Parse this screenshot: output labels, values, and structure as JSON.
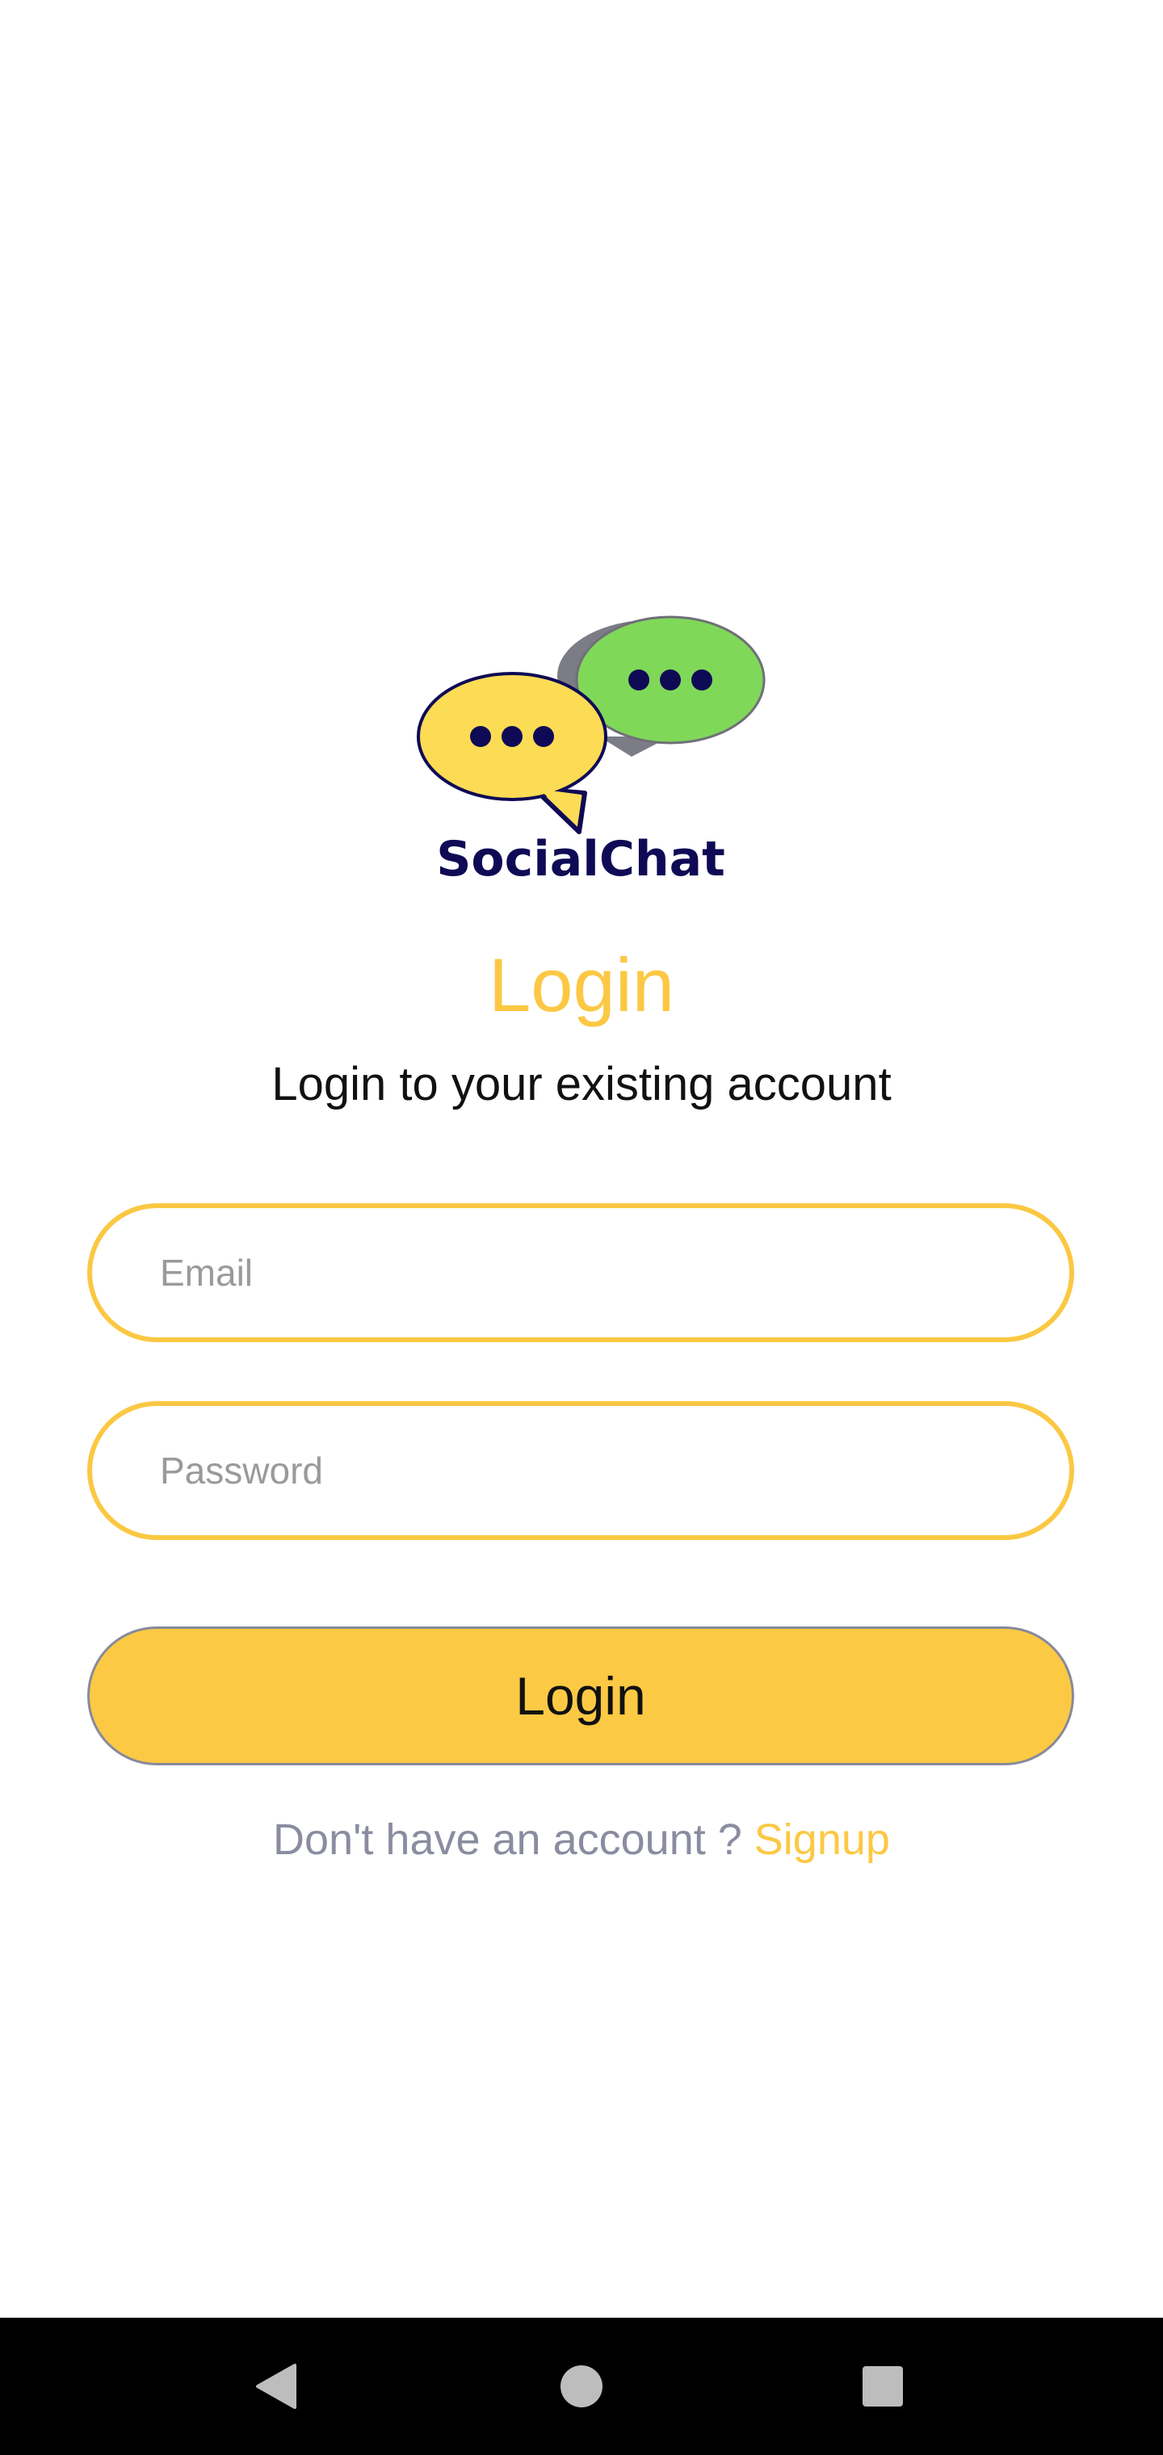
{
  "logo": {
    "brand_text": "SocialChat",
    "icon": "chat-bubbles-logo-icon",
    "colors": {
      "yellow": "#fcdc55",
      "green": "#7fd858",
      "navy": "#0f0a55"
    }
  },
  "header": {
    "title": "Login",
    "subtitle": "Login to your existing account"
  },
  "form": {
    "email_placeholder": "Email",
    "email_value": "",
    "password_placeholder": "Password",
    "password_value": "",
    "login_label": "Login"
  },
  "signup": {
    "prompt": "Don't have an account ?",
    "link_label": "Signup"
  },
  "navbar": {
    "back_icon": "back-triangle-icon",
    "home_icon": "home-circle-icon",
    "recents_icon": "recents-square-icon"
  },
  "theme": {
    "accent": "#fcc844",
    "muted_text": "#8a8ca0",
    "border": "#fbc843"
  }
}
